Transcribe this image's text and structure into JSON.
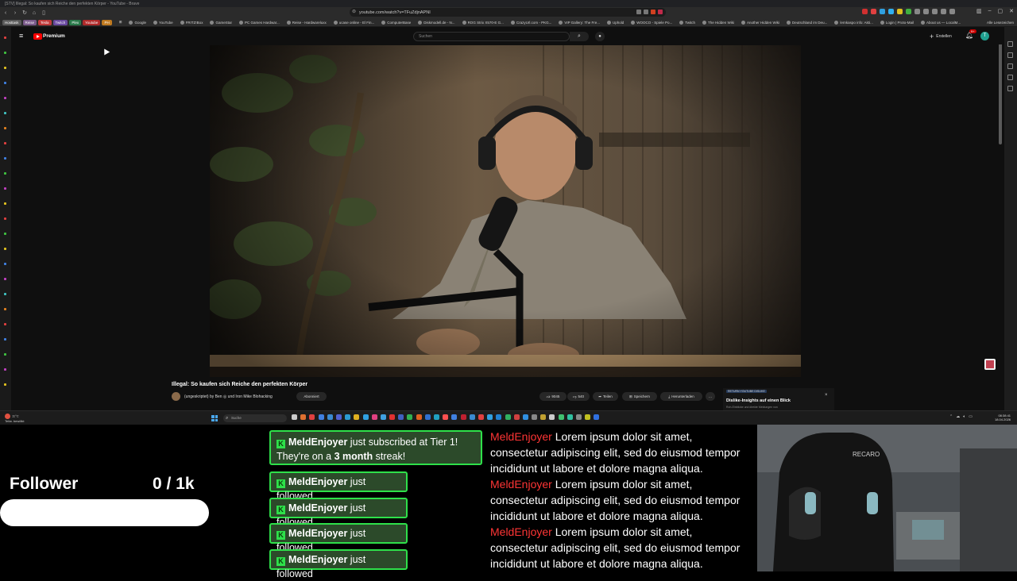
{
  "browser": {
    "window_title": "[STV] Illegal: So kaufen sich Reiche den perfekten Körper - YouTube - Brave",
    "url": "youtube.com/watch?v=TFuZdjnAPNI",
    "bookmark_tags": [
      {
        "label": "Hosttask",
        "color": "#5a5a5a"
      },
      {
        "label": "Reise",
        "color": "#7a5a8a"
      },
      {
        "label": "Tesla",
        "color": "#c03a3a"
      },
      {
        "label": "Twitch",
        "color": "#6a4aa0"
      },
      {
        "label": "Plex",
        "color": "#2a7a4a"
      },
      {
        "label": "Youtube",
        "color": "#b02a2a"
      },
      {
        "label": "PH",
        "color": "#c07a20"
      }
    ],
    "bookmarks": [
      "Google",
      "YouTube",
      "FRITZ!Box",
      "GameStar",
      "PC Games Hardwar...",
      "Reise - Hardwareluxx",
      "ucase online - El Fin...",
      "ComputerBase",
      "Diskmodell.de - N...",
      "ROG Strix X570-E G...",
      "CrazyUrl.com - PKG...",
      "VIP Gallery: The Fre...",
      "Uphold",
      "WOOCO - Spiele Po...",
      "Twitch",
      "The Hidden Wiki",
      "Another Hidden Wiki",
      "Deutschland im Deu...",
      "lernkaspo info: Akti...",
      "Login | Proto-Mail",
      "About us — LocalM..."
    ],
    "other_bookmarks": "Alle Lesezeichen"
  },
  "youtube": {
    "brand": "Premium",
    "search_placeholder": "Suchen",
    "create_label": "Erstellen",
    "notification_count": "9+",
    "avatar_letter": "T",
    "video_title": "Illegal: So kaufen sich Reiche den perfekten Körper",
    "channel": "(ungeskriptet) by Ben ◎ und Iron Mike Blohacking",
    "subscribe_label": "Abonniert",
    "likes": "9045",
    "dislikes": "540",
    "share_label": "Teilen",
    "save_label": "Speichern",
    "download_label": "Herunterladen",
    "more_label": "…",
    "ryd": {
      "tag": "RETURN YOUTUBE DISLIKE",
      "title": "Dislike-Insights auf einen Blick",
      "subtitle": "Roh-Einblicke und direkte Meldungen von",
      "close": "×"
    }
  },
  "taskbar": {
    "weather_temp": "11°C",
    "weather_text": "Teilw. bewölkt",
    "search_placeholder": "Suche",
    "time": "08:38:41",
    "date": "18.04.2026"
  },
  "overlay": {
    "follower_label": "Follower",
    "follower_count": "0 / 1k",
    "follower_progress": 0,
    "sub_alert": {
      "user": "MeldEnjoyer",
      "text": " just subscribed at Tier 1!",
      "line2_pre": "They're on a ",
      "streak": "3 month",
      "line2_post": " streak!"
    },
    "follow_alerts": [
      {
        "user": "MeldEnjoyer",
        "text": " just followed"
      },
      {
        "user": "MeldEnjoyer",
        "text": " just followed"
      },
      {
        "user": "MeldEnjoyer",
        "text": " just followed"
      },
      {
        "user": "MeldEnjoyer",
        "text": " just followed"
      }
    ],
    "chat": [
      {
        "user": "MeldEnjoyer",
        "text": " Lorem ipsum dolor sit amet, consectetur adipiscing elit, sed do eiusmod tempor incididunt ut labore et dolore magna aliqua."
      },
      {
        "user": "MeldEnjoyer",
        "text": " Lorem ipsum dolor sit amet, consectetur adipiscing elit, sed do eiusmod tempor incididunt ut labore et dolore magna aliqua."
      },
      {
        "user": "MeldEnjoyer",
        "text": " Lorem ipsum dolor sit amet, consectetur adipiscing elit, sed do eiusmod tempor incididunt ut labore et dolore magna aliqua."
      }
    ]
  },
  "colors": {
    "alert_border": "#2ee04a",
    "alert_bg": "#2c4a2a",
    "chat_user": "#ff3535",
    "youtube_red": "#ff0000"
  }
}
